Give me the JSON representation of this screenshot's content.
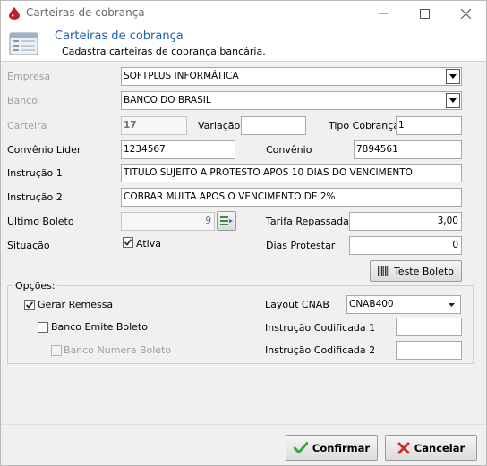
{
  "window": {
    "title": "Carteiras de cobrança"
  },
  "header": {
    "title": "Carteiras de cobrança",
    "subtitle": "Cadastra carteiras de cobrança bancária."
  },
  "form": {
    "empresa": {
      "label": "Empresa",
      "value": "SOFTPLUS INFORMÁTICA"
    },
    "banco": {
      "label": "Banco",
      "value": "BANCO DO BRASIL"
    },
    "carteira": {
      "label": "Carteira",
      "value": "17"
    },
    "variacao": {
      "label": "Variação",
      "value": ""
    },
    "tipo_cobranca": {
      "label": "Tipo Cobrança",
      "value": "1"
    },
    "convenio_lider": {
      "label": "Convênio Líder",
      "value": "1234567"
    },
    "convenio": {
      "label": "Convênio",
      "value": "7894561"
    },
    "instrucao1": {
      "label": "Instrução 1",
      "value": "TITULO SUJEITO A PROTESTO APOS 10 DIAS DO VENCIMENTO"
    },
    "instrucao2": {
      "label": "Instrução 2",
      "value": "COBRAR MULTA APOS O VENCIMENTO DE 2%"
    },
    "ultimo_boleto": {
      "label": "Último Boleto",
      "value": "9"
    },
    "tarifa_repassada": {
      "label": "Tarifa Repassada",
      "value": "3,00"
    },
    "situacao": {
      "label": "Situação",
      "checkbox_label": "Ativa",
      "checked": true
    },
    "dias_protestar": {
      "label": "Dias Protestar",
      "value": "0"
    },
    "teste_boleto": {
      "label": "Teste Boleto"
    }
  },
  "opcoes": {
    "title": "Opções:",
    "gerar_remessa": {
      "label": "Gerar Remessa",
      "checked": true
    },
    "banco_emite_boleto": {
      "label": "Banco Emite Boleto",
      "checked": false
    },
    "banco_numera_boleto": {
      "label": "Banco Numera Boleto",
      "checked": false
    },
    "layout_cnab": {
      "label": "Layout CNAB",
      "value": "CNAB400"
    },
    "instrucao_codificada1": {
      "label": "Instrução Codificada 1",
      "value": ""
    },
    "instrucao_codificada2": {
      "label": "Instrução Codificada 2",
      "value": ""
    }
  },
  "footer": {
    "confirm": {
      "label_first": "C",
      "label_rest": "onfirmar"
    },
    "cancel": {
      "label_first": "Ca",
      "label_u": "n",
      "label_rest": "celar"
    }
  },
  "colors": {
    "header_title": "#1e5fa8",
    "confirm_icon": "#3aa63a",
    "cancel_icon": "#d22b2b",
    "app_icon": "#c0202a"
  },
  "icons": [
    "drop-icon",
    "minimize-icon",
    "maximize-icon",
    "close-icon",
    "form-icon",
    "dropdown-arrow-icon",
    "list-settings-icon",
    "barcode-icon",
    "check-icon",
    "cross-icon"
  ]
}
